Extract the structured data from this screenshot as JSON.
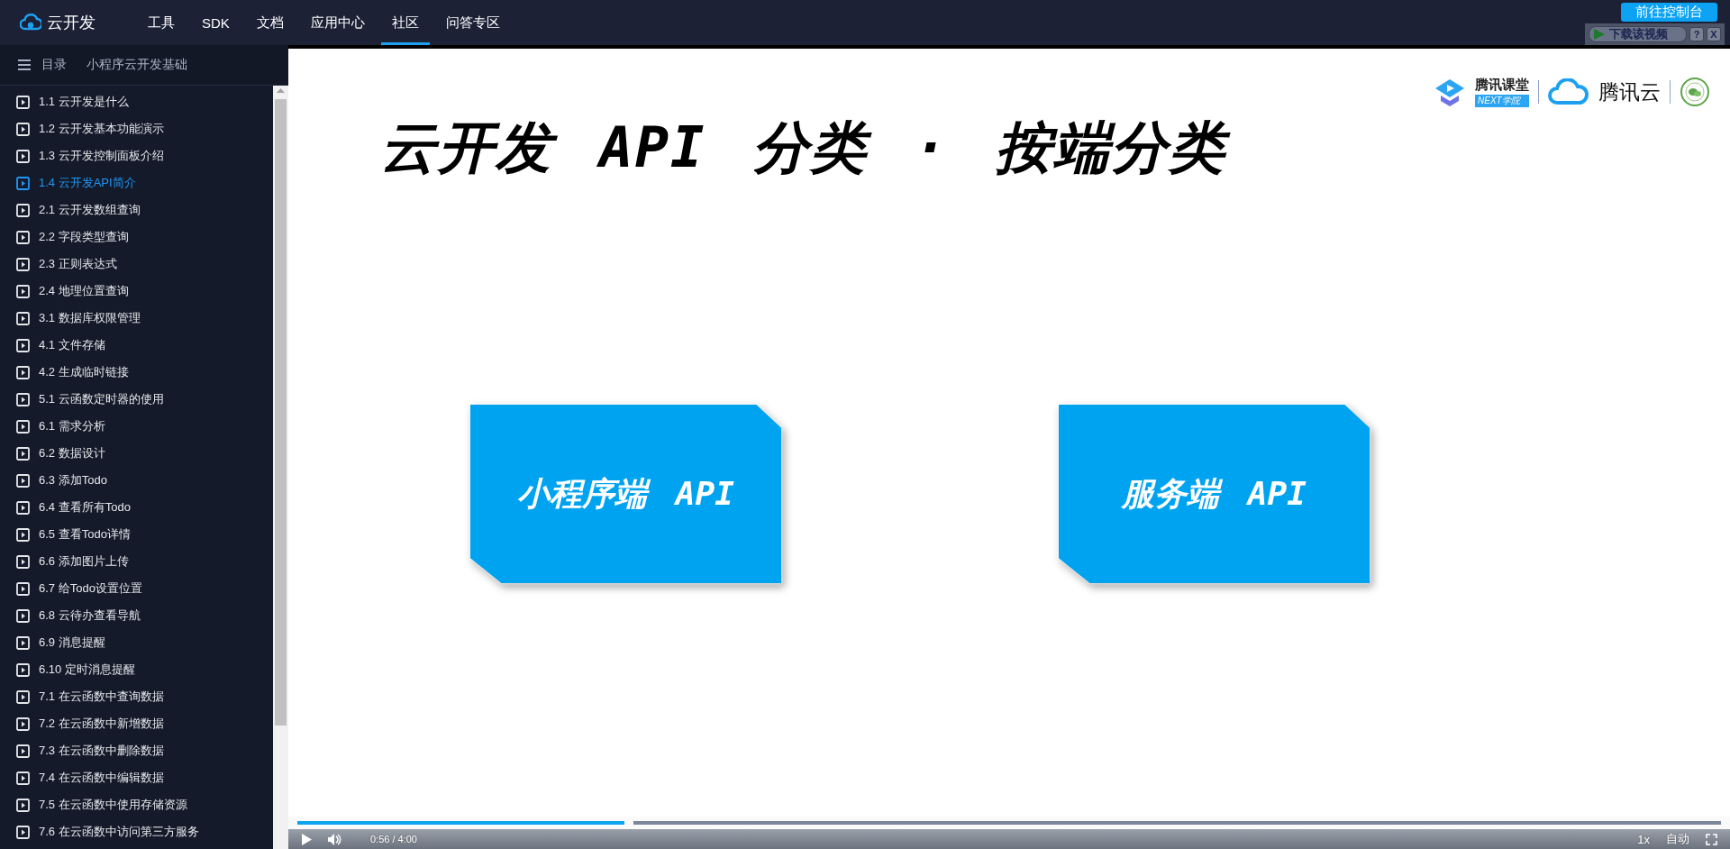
{
  "brand": {
    "name": "云开发"
  },
  "nav": [
    {
      "label": "工具",
      "selected": false
    },
    {
      "label": "SDK",
      "selected": false
    },
    {
      "label": "文档",
      "selected": false
    },
    {
      "label": "应用中心",
      "selected": false
    },
    {
      "label": "社区",
      "selected": true
    },
    {
      "label": "问答专区",
      "selected": false
    }
  ],
  "console_button": "前往控制台",
  "download_overlay": {
    "label": "下载该视频",
    "help": "?",
    "close": "X"
  },
  "sidebar": {
    "menu_label": "目录",
    "course_title": "小程序云开发基础",
    "items": [
      {
        "label": "1.1 云开发是什么",
        "selected": false
      },
      {
        "label": "1.2 云开发基本功能演示",
        "selected": false
      },
      {
        "label": "1.3 云开发控制面板介绍",
        "selected": false
      },
      {
        "label": "1.4 云开发API简介",
        "selected": true
      },
      {
        "label": "2.1 云开发数组查询",
        "selected": false
      },
      {
        "label": "2.2 字段类型查询",
        "selected": false
      },
      {
        "label": "2.3 正则表达式",
        "selected": false
      },
      {
        "label": "2.4 地理位置查询",
        "selected": false
      },
      {
        "label": "3.1 数据库权限管理",
        "selected": false
      },
      {
        "label": "4.1 文件存储",
        "selected": false
      },
      {
        "label": "4.2 生成临时链接",
        "selected": false
      },
      {
        "label": "5.1 云函数定时器的使用",
        "selected": false
      },
      {
        "label": "6.1 需求分析",
        "selected": false
      },
      {
        "label": "6.2 数据设计",
        "selected": false
      },
      {
        "label": "6.3 添加Todo",
        "selected": false
      },
      {
        "label": "6.4 查看所有Todo",
        "selected": false
      },
      {
        "label": "6.5 查看Todo详情",
        "selected": false
      },
      {
        "label": "6.6 添加图片上传",
        "selected": false
      },
      {
        "label": "6.7 给Todo设置位置",
        "selected": false
      },
      {
        "label": "6.8 云待办查看导航",
        "selected": false
      },
      {
        "label": "6.9 消息提醒",
        "selected": false
      },
      {
        "label": "6.10 定时消息提醒",
        "selected": false
      },
      {
        "label": "7.1 在云函数中查询数据",
        "selected": false
      },
      {
        "label": "7.2 在云函数中新增数据",
        "selected": false
      },
      {
        "label": "7.3 在云函数中删除数据",
        "selected": false
      },
      {
        "label": "7.4 在云函数中编辑数据",
        "selected": false
      },
      {
        "label": "7.5 在云函数中使用存储资源",
        "selected": false
      },
      {
        "label": "7.6 在云函数中访问第三方服务",
        "selected": false
      }
    ]
  },
  "slide": {
    "logos": {
      "tencent_class": "腾讯课堂",
      "next": "NEXT学院",
      "tencent_cloud": "腾讯云"
    },
    "title": "云开发 API 分类 · 按端分类",
    "cards": [
      "小程序端 API",
      "服务端 API"
    ]
  },
  "player": {
    "progress": {
      "level": 0.23
    },
    "time": "0:56 / 4:00",
    "speed": "1x",
    "quality": "自动"
  }
}
